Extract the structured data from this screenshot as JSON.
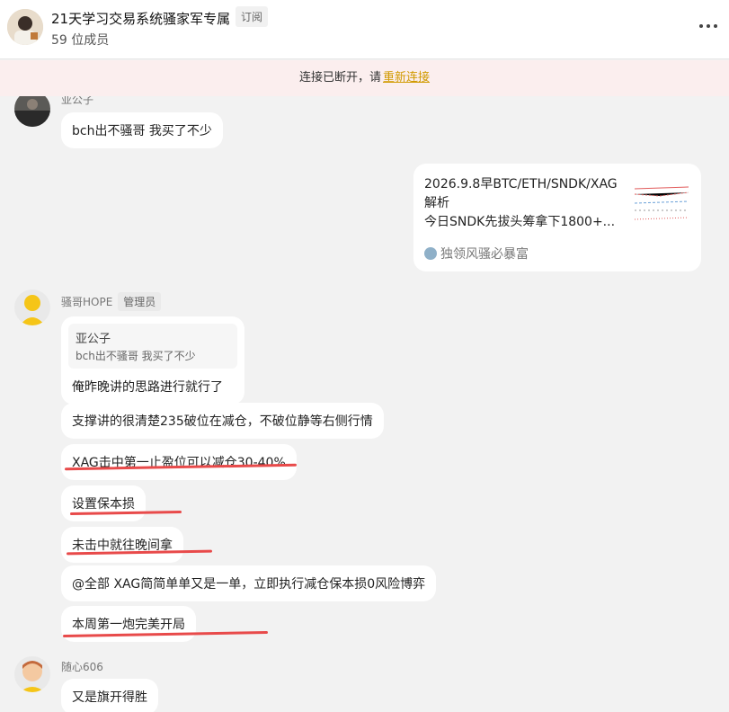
{
  "header": {
    "title": "21天学习交易系统骚家军专属",
    "tag": "订阅",
    "members": "59 位成员"
  },
  "banner": {
    "text": "连接已断开，请",
    "link": "重新连接"
  },
  "messages": {
    "m1": {
      "sender": "亚公子",
      "text": "bch出不骚哥 我买了不少"
    },
    "card": {
      "lines": [
        "2026.9.8早BTC/ETH/SNDK/XAG",
        "解析",
        "今日SNDK先拔头筹拿下1800+..."
      ],
      "source": "独领风骚必暴富"
    },
    "m2": {
      "sender": "骚哥HOPE",
      "badge": "管理员",
      "quote_name": "亚公子",
      "quote_text": "bch出不骚哥 我买了不少",
      "reply": "俺昨晚讲的思路进行就行了",
      "b1": "支撑讲的很清楚235破位在减仓，不破位静等右侧行情",
      "b2": "XAG击中第一止盈位可以减仓30-40%",
      "b3": "设置保本损",
      "b4": "未击中就往晚间拿",
      "b5": "@全部  XAG简简单单又是一单，立即执行减仓保本损0风险博弈",
      "b6": "本周第一炮完美开局"
    },
    "m3": {
      "sender": "随心606",
      "text": "又是旗开得胜"
    }
  },
  "colors": {
    "underline": "#e84a4a",
    "link": "#d19a00",
    "banner_bg": "#fbeeee"
  }
}
